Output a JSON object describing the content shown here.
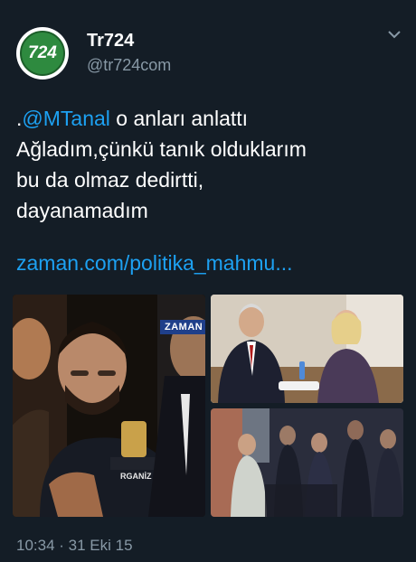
{
  "tweet": {
    "avatar_text": "724",
    "display_name": "Tr724",
    "handle": "@tr724com",
    "text_prefix": ".",
    "mention": "@MTanal",
    "line1_rest": " o anları anlattı",
    "line2": "Ağladım,çünkü tanık olduklarım",
    "line3": "bu da olmaz dedirtti,",
    "line4": "dayanamadım",
    "link": "zaman.com/politika_mahmu...",
    "watermark": "ZAMAN",
    "badge_text": "RGANİZ",
    "timestamp": "10:34 · 31 Eki 15"
  },
  "icons": {
    "menu": "chevron-down-icon"
  },
  "colors": {
    "background": "#141d26",
    "link": "#1da1f2",
    "muted": "#8899a6",
    "brand_green": "#2e8a3f"
  }
}
